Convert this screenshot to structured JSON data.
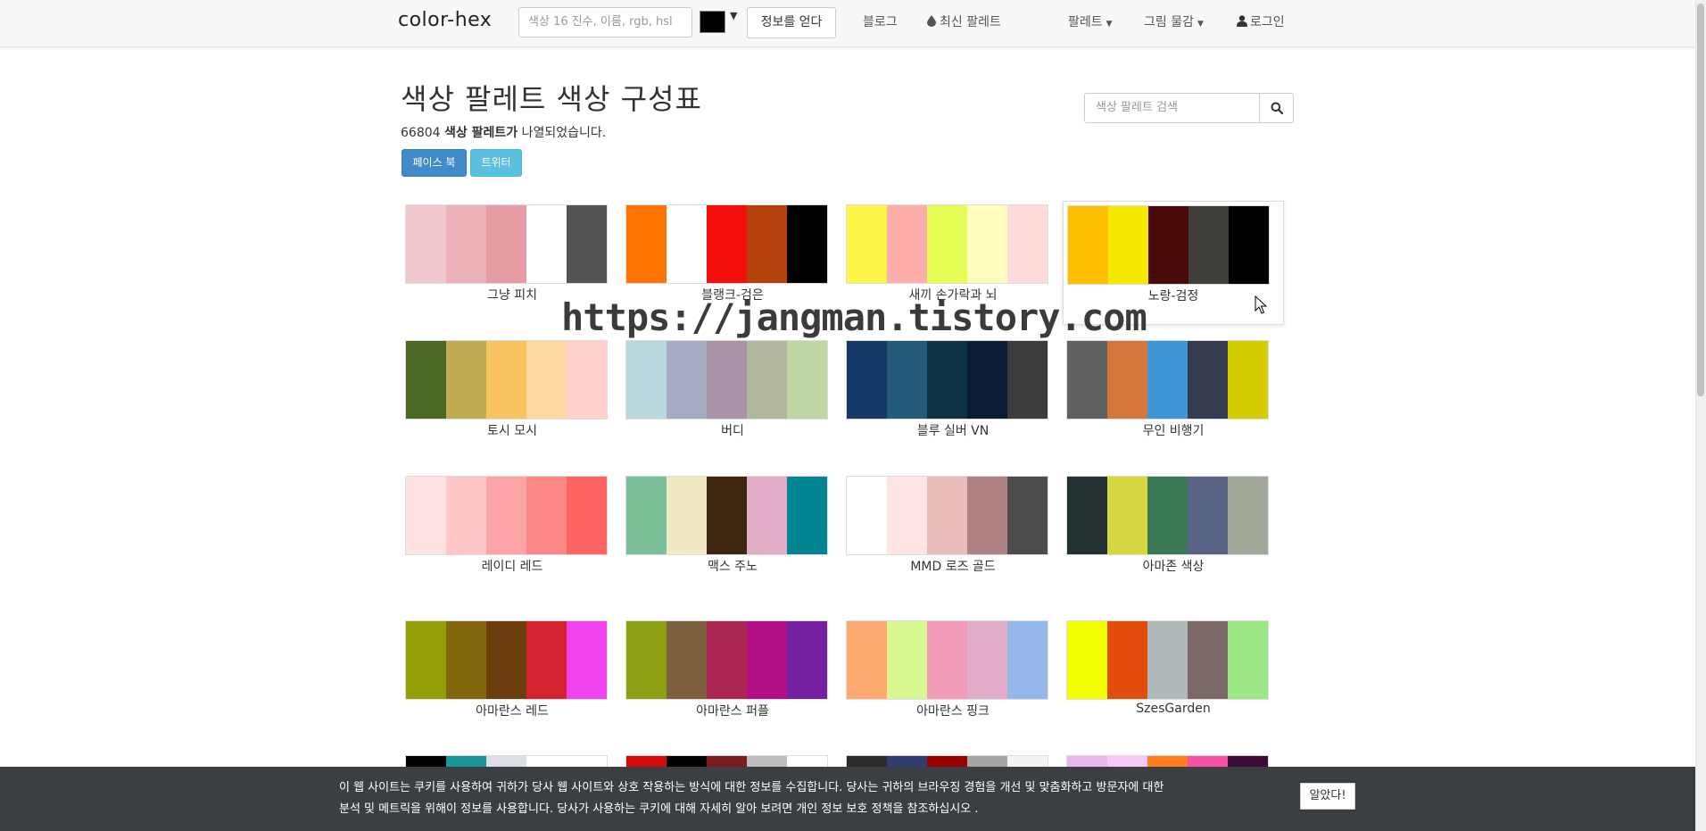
{
  "navbar": {
    "brand": "color-hex",
    "search_placeholder": "색상 16 진수, 이름, rgb, hsl",
    "swatch_color": "#000000",
    "get_info_label": "정보를 얻다",
    "blog_label": "블로그",
    "latest_palette_label": "최신 팔레트",
    "palette_menu_label": "팔레트",
    "paint_menu_label": "그림 물감",
    "login_label": "로그인"
  },
  "header": {
    "title": "색상 팔레트 색상 구성표",
    "count": "66804",
    "count_bold": "색상 팔레트가",
    "count_suffix": "나열되었습니다.",
    "facebook_label": "페이스 북",
    "twitter_label": "트위터",
    "palette_search_placeholder": "색상 팔레트 검색"
  },
  "watermark": "https://jangman.tistory.com",
  "palettes": [
    {
      "name": "그냥 피치",
      "colors": [
        "#efc7cc",
        "#ecb0b8",
        "#e69aa3",
        "#ffffff",
        "#545454"
      ]
    },
    {
      "name": "블랭크-검은",
      "colors": [
        "#ff7400",
        "#ffffff",
        "#f40f0b",
        "#b5420d",
        "#000000"
      ]
    },
    {
      "name": "새끼 손가락과 뇌",
      "colors": [
        "#fdf54a",
        "#fdaeab",
        "#e6fd55",
        "#fffdbd",
        "#fedadb"
      ]
    },
    {
      "name": "노랑-검정",
      "colors": [
        "#ffbf00",
        "#f5e800",
        "#4b0a0a",
        "#403f3c",
        "#000000"
      ]
    },
    {
      "name": "토시 모시",
      "colors": [
        "#4a6723",
        "#bfab52",
        "#f7c45f",
        "#fdd8a0",
        "#fdd2cc"
      ]
    },
    {
      "name": "버디",
      "colors": [
        "#b8d8dd",
        "#a6abc3",
        "#aa92a7",
        "#b1b69f",
        "#bfd7a5"
      ]
    },
    {
      "name": "블루 실버 VN",
      "colors": [
        "#143966",
        "#235c7b",
        "#0d3246",
        "#0b1b34",
        "#3d3d3d"
      ]
    },
    {
      "name": "무인 비행기",
      "colors": [
        "#616161",
        "#d5763a",
        "#3e96d6",
        "#363a50",
        "#d4cc00"
      ]
    },
    {
      "name": "레이디 레드",
      "colors": [
        "#fee2e2",
        "#fec7c8",
        "#fda5a6",
        "#fd8687",
        "#fe6464"
      ]
    },
    {
      "name": "맥스 주노",
      "colors": [
        "#7cc09a",
        "#f0e9c4",
        "#3e2710",
        "#e1adc7",
        "#018592"
      ]
    },
    {
      "name": "MMD 로즈 골드",
      "colors": [
        "#ffffff",
        "#ffe5e3",
        "#e9bdb9",
        "#ae8185",
        "#4d4d4d"
      ]
    },
    {
      "name": "아마존 색상",
      "colors": [
        "#243133",
        "#d6d742",
        "#3b7a57",
        "#5a6485",
        "#a1a899"
      ]
    },
    {
      "name": "아마란스 레드",
      "colors": [
        "#939f04",
        "#82670d",
        "#6c3d0c",
        "#d42231",
        "#f043ef"
      ]
    },
    {
      "name": "아마란스 퍼플",
      "colors": [
        "#8d9f13",
        "#7e5f3e",
        "#ab2751",
        "#b10e84",
        "#731f9f"
      ]
    },
    {
      "name": "아마란스 핑크",
      "colors": [
        "#fda871",
        "#d8f790",
        "#f29bbb",
        "#e1adc8",
        "#95b7ea"
      ]
    },
    {
      "name": "SzesGarden",
      "colors": [
        "#f1ff00",
        "#e34d0c",
        "#b0b8b9",
        "#7c6866",
        "#9de787"
      ]
    },
    {
      "name": "",
      "colors": [
        "#000000",
        "#1b9696",
        "#dedee6",
        "#ffffff",
        "#ffffff"
      ]
    },
    {
      "name": "",
      "colors": [
        "#d40a0a",
        "#000000",
        "#781c1c",
        "#bdbdbd",
        "#ffffff"
      ]
    },
    {
      "name": "",
      "colors": [
        "#2b2b2b",
        "#2f3e6e",
        "#9a0000",
        "#a5a5a5",
        "#f3f3f3"
      ]
    },
    {
      "name": "",
      "colors": [
        "#e8b7ec",
        "#f8c8f6",
        "#ff7e1d",
        "#f74fa1",
        "#3d0a38"
      ]
    }
  ],
  "cookie": {
    "line1": "이 웹 사이트는 쿠키를 사용하여 귀하가 당사 웹 사이트와 상호 작용하는 방식에 대한 정보를 수집합니다. 당사는 귀하의 브라우징 경험을 개선 및 맞춤화하고 방문자에 대한",
    "line2": "분석 및 메트릭을 위해이 정보를 사용합니다. 당사가 사용하는 쿠키에 대해 자세히 알아 보려면 개인 정보 보호 정책을 참조하십시오 .",
    "accept_label": "알았다!"
  }
}
